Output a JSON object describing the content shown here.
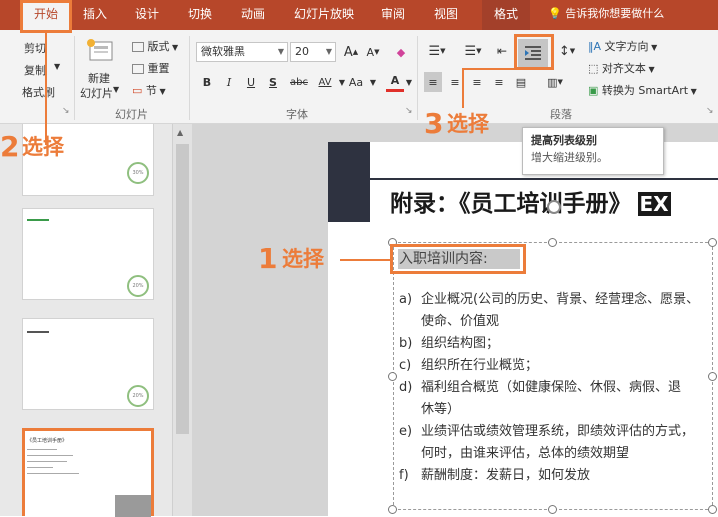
{
  "tabs": [
    "开始",
    "插入",
    "设计",
    "切换",
    "动画",
    "幻灯片放映",
    "审阅",
    "视图",
    "格式"
  ],
  "tell_me": "告诉我你想要做什么",
  "clipboard": {
    "cut": "剪切",
    "copy": "复制",
    "painter": "格式刷"
  },
  "slides_group": {
    "new_slide": [
      "新建",
      "幻灯片"
    ],
    "layout": "版式",
    "reset": "重置",
    "section": "节",
    "label": "幻灯片"
  },
  "font_group": {
    "font_name": "微软雅黑",
    "font_size": "20",
    "bold": "B",
    "italic": "I",
    "underline": "U",
    "shadow": "S",
    "strike": "abc",
    "spacing": "AV",
    "case": "Aa",
    "color": "A",
    "label": "字体"
  },
  "paragraph_group": {
    "text_direction": "文字方向",
    "align_text": "对齐文本",
    "smartart": "转换为 SmartArt",
    "label": "段落"
  },
  "tooltip": {
    "title": "提高列表级别",
    "desc": "增大缩进级别。"
  },
  "thumbs": [
    {
      "badge": "30%"
    },
    {
      "badge": "20%"
    },
    {
      "badge": "20%"
    },
    {
      "title": "《员工培训手册》"
    }
  ],
  "slide": {
    "title": "附录：《员工培训手册》",
    "title_suffix": "EX",
    "heading": "入职培训内容:",
    "items": [
      {
        "m": "a)",
        "t": "企业概况(公司的历史、背景、经营理念、愿景、"
      },
      {
        "m": "",
        "t": "使命、价值观"
      },
      {
        "m": "b)",
        "t": "组织结构图；"
      },
      {
        "m": "c)",
        "t": "组织所在行业概览；"
      },
      {
        "m": "d)",
        "t": "福利组合概览（如健康保险、休假、病假、退"
      },
      {
        "m": "",
        "t": "休等）"
      },
      {
        "m": "e)",
        "t": "业绩评估或绩效管理系统，即绩效评估的方式，"
      },
      {
        "m": "",
        "t": "何时，由谁来评估，总体的绩效期望"
      },
      {
        "m": "f)",
        "t": "薪酬制度：发薪日，如何发放"
      }
    ]
  },
  "callouts": {
    "n1": "1",
    "t1": "选择",
    "n2": "2",
    "t2": "选择",
    "n3": "3",
    "t3": "选择"
  },
  "colors": {
    "accent": "#b7472a",
    "callout": "#ec7c3a"
  }
}
